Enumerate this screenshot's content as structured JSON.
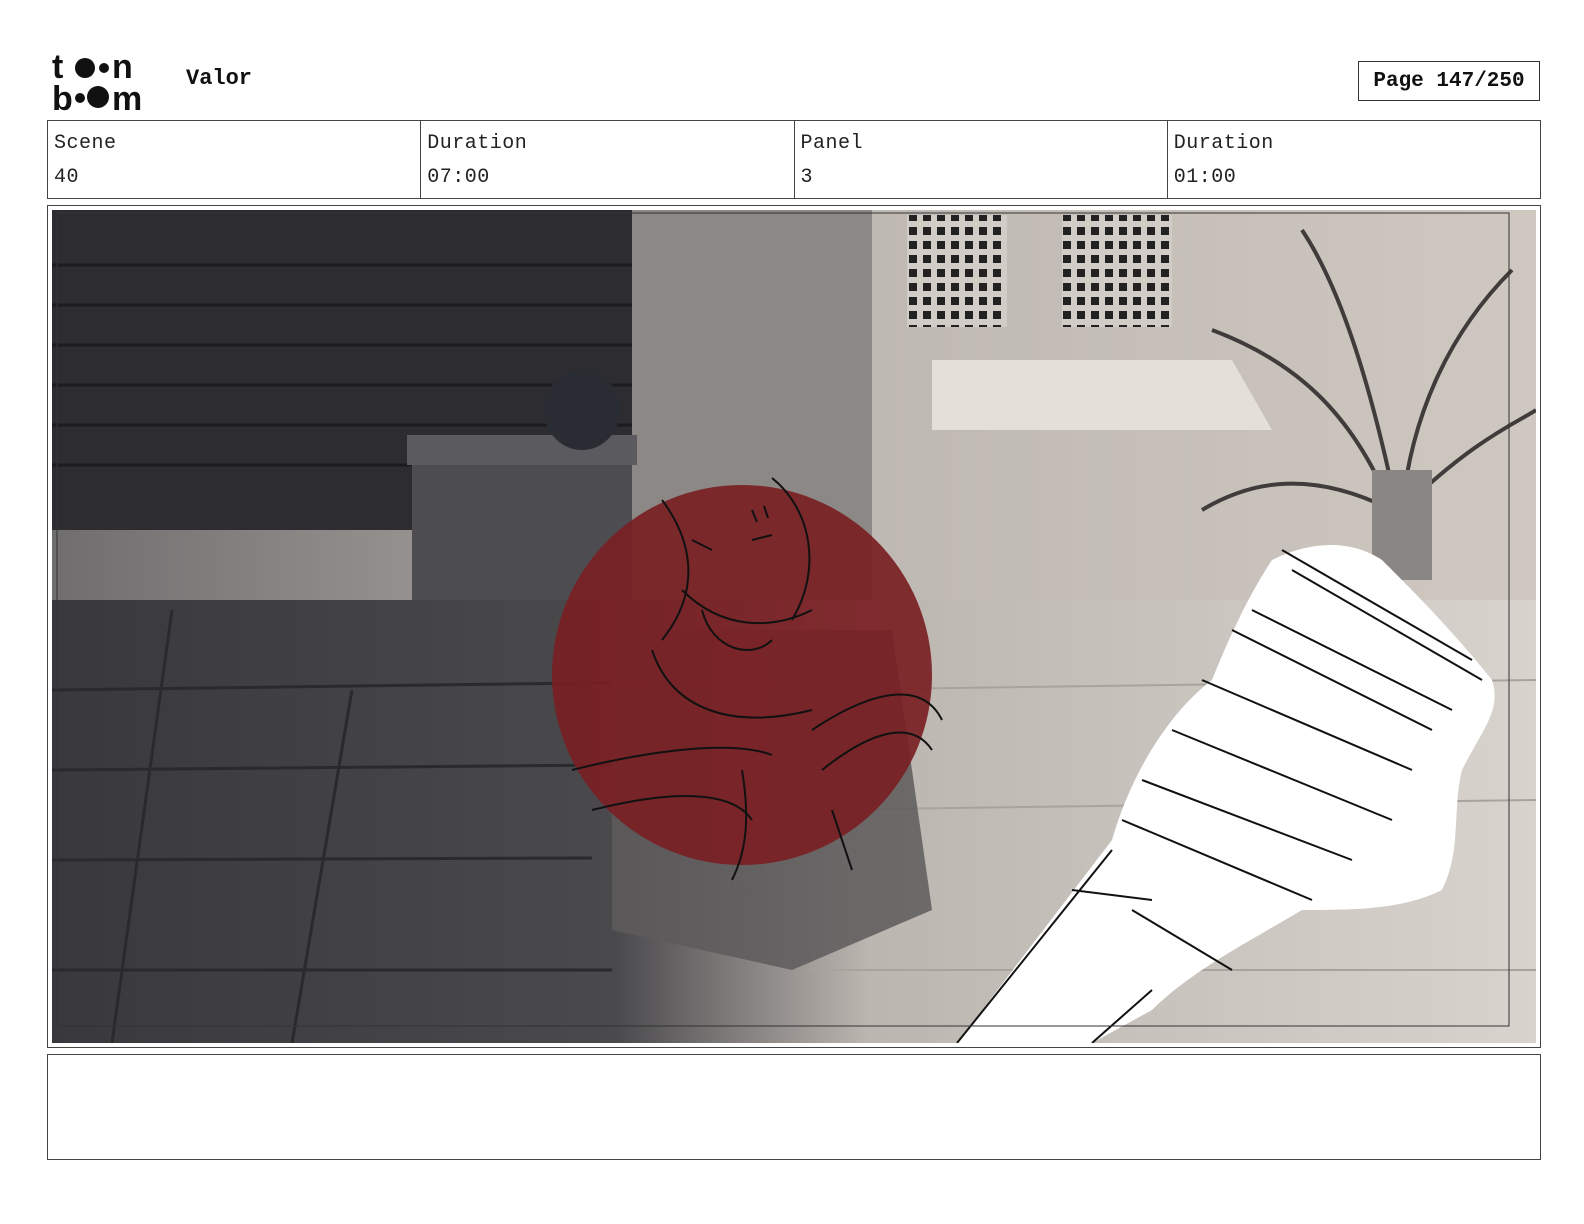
{
  "header": {
    "logo_alt": "toon boom",
    "project_title": "Valor",
    "page_label": "Page 147/250"
  },
  "info": {
    "scene_label": "Scene",
    "scene_value": "40",
    "scene_duration_label": "Duration",
    "scene_duration_value": "07:00",
    "panel_label": "Panel",
    "panel_value": "3",
    "panel_duration_label": "Duration",
    "panel_duration_value": "01:00"
  },
  "panel": {
    "description_icon": "storyboard-panel-image"
  },
  "notes": {
    "text": ""
  },
  "colors": {
    "ink": "#111111",
    "red_figure": "#7a1f24",
    "floor_dark": "#3a3a3e",
    "floor_light": "#cfc9c3"
  }
}
